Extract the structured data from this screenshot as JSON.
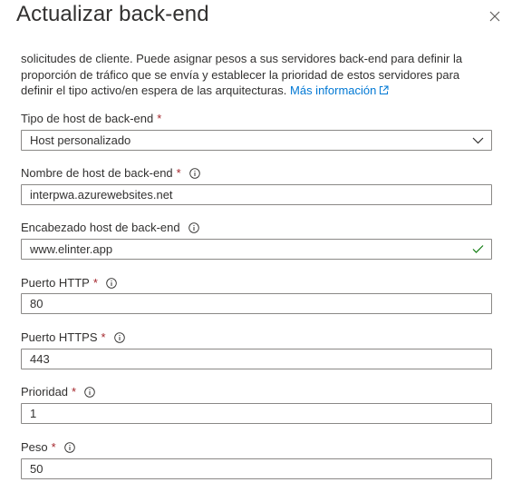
{
  "dialog": {
    "title": "Actualizar back-end"
  },
  "description": {
    "text": "solicitudes de cliente. Puede asignar pesos a sus servidores back-end para definir la proporción de tráfico que se envía y establecer la prioridad de estos servidores para definir el tipo activo/en espera de las arquitecturas.",
    "link_label": "Más información"
  },
  "fields": {
    "host_type": {
      "label": "Tipo de host de back-end",
      "required": "*",
      "value": "Host personalizado"
    },
    "host_name": {
      "label": "Nombre de host de back-end",
      "required": "*",
      "value": "interpwa.azurewebsites.net"
    },
    "host_header": {
      "label": "Encabezado host de back-end",
      "value": "www.elinter.app"
    },
    "http_port": {
      "label": "Puerto HTTP",
      "required": "*",
      "value": "80"
    },
    "https_port": {
      "label": "Puerto HTTPS",
      "required": "*",
      "value": "443"
    },
    "priority": {
      "label": "Prioridad",
      "required": "*",
      "value": "1"
    },
    "weight": {
      "label": "Peso",
      "required": "*",
      "value": "50"
    }
  },
  "icons": {
    "close": "close-icon",
    "external_link": "external-link-icon",
    "info": "info-icon",
    "chevron": "chevron-down-icon",
    "check": "checkmark-icon"
  },
  "colors": {
    "link": "#0078d4",
    "required": "#a4262c",
    "valid": "#107c10",
    "border": "#8a8886"
  }
}
